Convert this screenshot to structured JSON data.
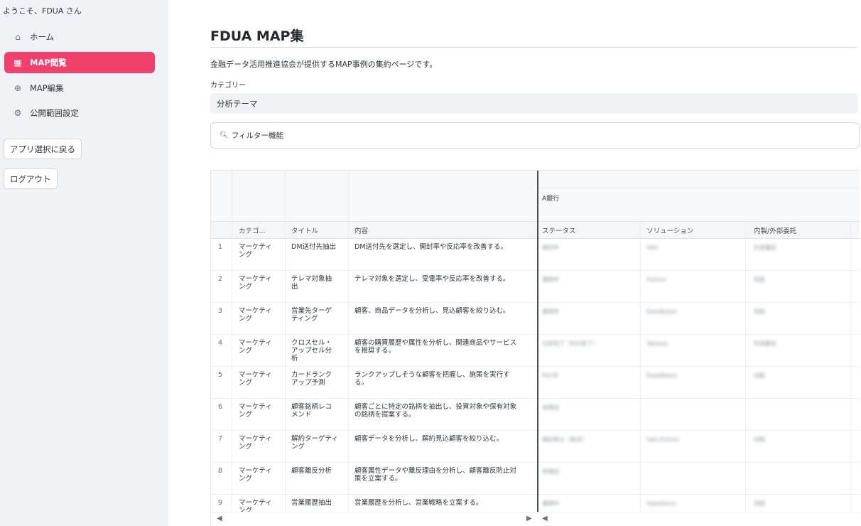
{
  "sidebar": {
    "welcome": "ようこそ、FDUA さん",
    "items": [
      {
        "label": "ホーム",
        "icon": "home-icon",
        "active": false
      },
      {
        "label": "MAP閲覧",
        "icon": "table-icon",
        "active": true
      },
      {
        "label": "MAP編集",
        "icon": "plus-circle-icon",
        "active": false
      },
      {
        "label": "公開範囲設定",
        "icon": "gear-icon",
        "active": false
      }
    ],
    "back_button": "アプリ選択に戻る",
    "logout_button": "ログアウト"
  },
  "main": {
    "title": "FDUA MAP集",
    "description": "金融データ活用推進協会が提供するMAP事例の集約ページです。",
    "category_label": "カテゴリー",
    "category_value": "分析テーマ",
    "filter_label": "フィルター機能"
  },
  "grid": {
    "group_header": "A銀行",
    "columns": [
      "カテゴ...",
      "タイトル",
      "内容",
      "ステータス",
      "ソリューション",
      "内製/外部委託"
    ],
    "rows": [
      {
        "n": "1",
        "category": [
          "マーケティ",
          "ング"
        ],
        "title": [
          "DM送付先抽出"
        ],
        "content": [
          "DM送付先を選定し、開封率や反応率を改善する。"
        ],
        "status": "検討中",
        "solution": "SAS",
        "mode": "外部委託"
      },
      {
        "n": "2",
        "category": [
          "マーケティ",
          "ング"
        ],
        "title": [
          "テレマ対象抽",
          "出"
        ],
        "content": [
          "テレマ対象を選定し、受電率や反応率を改善する。"
        ],
        "status": "運用中",
        "solution": "Python",
        "mode": "内製"
      },
      {
        "n": "3",
        "category": [
          "マーケティ",
          "ング"
        ],
        "title": [
          "営業先ターゲ",
          "ティング"
        ],
        "content": [
          "顧客、商品データを分析し、見込顧客を絞り込む。"
        ],
        "status": "運用中",
        "solution": "DataRobot",
        "mode": "内製"
      },
      {
        "n": "4",
        "category": [
          "マーケティ",
          "ング"
        ],
        "title": [
          "クロスセル・",
          "アップセル分",
          "析"
        ],
        "content": [
          "顧客の購買履歴や属性を分析し、関連商品やサービス",
          "を推奨する。"
        ],
        "status": "分析完了（PoC終了）",
        "solution": "Tableau",
        "mode": "外部委託"
      },
      {
        "n": "5",
        "category": [
          "マーケティ",
          "ング"
        ],
        "title": [
          "カードランク",
          "アップ予測"
        ],
        "content": [
          "ランクアップしそうな顧客を把握し、施策を実行す",
          "る。"
        ],
        "status": "PoC中",
        "solution": "DataRobot",
        "mode": "内製"
      },
      {
        "n": "6",
        "category": [
          "マーケティ",
          "ング"
        ],
        "title": [
          "顧客銘柄レコ",
          "メンド"
        ],
        "content": [
          "顧客ごとに特定の銘柄を抽出し、投資対象や保有対象",
          "の銘柄を提案する。"
        ],
        "status": "未検討",
        "solution": "",
        "mode": ""
      },
      {
        "n": "7",
        "category": [
          "マーケティ",
          "ング"
        ],
        "title": [
          "解約ターゲティ",
          "ング"
        ],
        "content": [
          "顧客データを分析し、解約見込顧客を絞り込む。"
        ],
        "status": "検討停止（断念）",
        "solution": "SAS,Python",
        "mode": "内製"
      },
      {
        "n": "8",
        "category": [
          "マーケティ",
          "ング"
        ],
        "title": [
          "顧客離反分析"
        ],
        "content": [
          "顧客属性データや離反理由を分析し、顧客離反防止対",
          "策を立案する。"
        ],
        "status": "未検討",
        "solution": "",
        "mode": ""
      },
      {
        "n": "9",
        "category": [
          "マーケティ",
          "ング"
        ],
        "title": [
          "営業履歴抽出"
        ],
        "content": [
          "営業履歴を分析し、営業戦略を立案する。"
        ],
        "status": "運用中",
        "solution": "Salesforce",
        "mode": "内製"
      }
    ]
  },
  "icons": {
    "search": "search-icon",
    "scroll_left": "chevron-left-icon",
    "scroll_right": "chevron-right-icon"
  },
  "colors": {
    "accent": "#f0416c",
    "sidebar_bg": "#f0f2f6"
  }
}
